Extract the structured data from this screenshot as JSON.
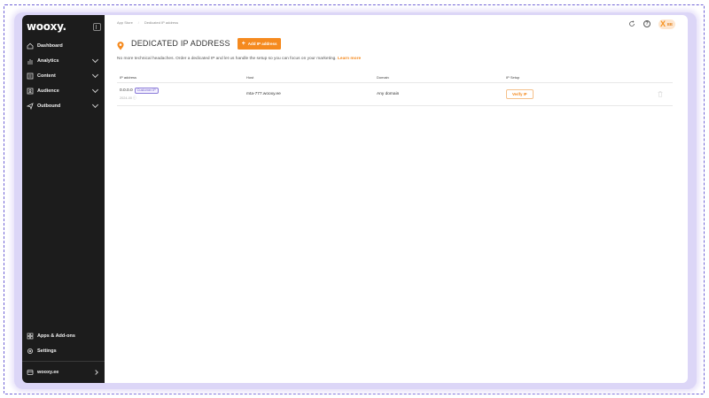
{
  "sidebar": {
    "logo": "wooxy.",
    "items": [
      {
        "label": "Dashboard",
        "icon": "home-icon"
      },
      {
        "label": "Analytics",
        "icon": "chart-icon"
      },
      {
        "label": "Content",
        "icon": "content-icon"
      },
      {
        "label": "Audience",
        "icon": "audience-icon"
      },
      {
        "label": "Outbound",
        "icon": "send-icon"
      }
    ],
    "bottom": [
      {
        "label": "Apps & Add-ons",
        "icon": "grid-icon"
      },
      {
        "label": "Settings",
        "icon": "gear-icon"
      },
      {
        "label": "wooxy.ee",
        "icon": "account-icon"
      }
    ]
  },
  "breadcrumb": {
    "first": "App Store",
    "second": "Dedicated IP address"
  },
  "topbar": {
    "lang": "EE"
  },
  "page": {
    "title": "DEDICATED IP ADDRESS",
    "add_button": "Add IP address",
    "description": "No more technical headaches. Order a dedicated IP and let us handle the setup so you can focus on your marketing.",
    "learn_more": "Learn more"
  },
  "table": {
    "headers": [
      "IP address",
      "Host",
      "Domain",
      "IP Setup"
    ],
    "rows": [
      {
        "ip": "0.0.0.0",
        "badge": "Customer IP",
        "sub": "2024-00",
        "host": "mta-777.wooxy.ee",
        "domain": "Any domain",
        "action": "Verify IP"
      }
    ]
  },
  "colors": {
    "accent": "#f58a1f",
    "sidebar_bg": "#1c1c1c",
    "badge": "#6d5bc9"
  }
}
